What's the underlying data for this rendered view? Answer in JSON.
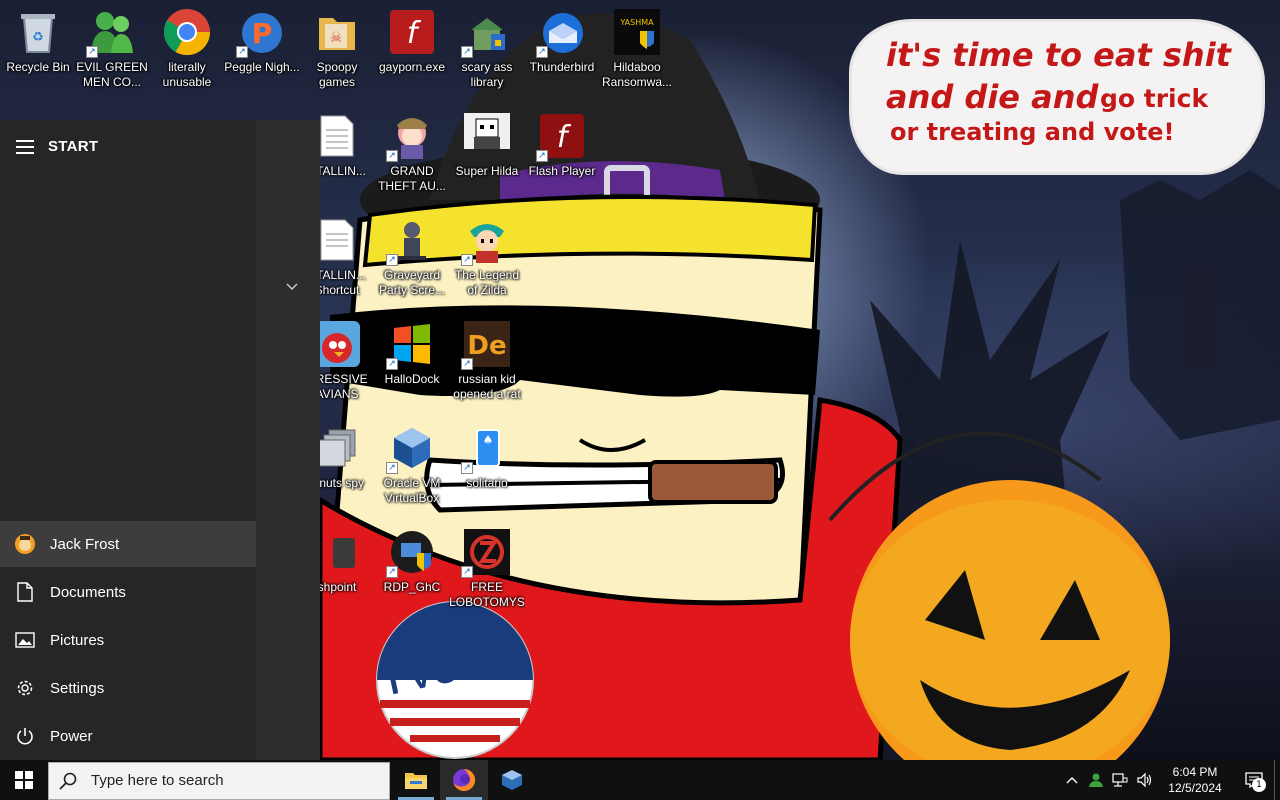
{
  "wallpaper": {
    "speech_bubble": {
      "line1": "it's time to eat shit",
      "line2a": "and die and",
      "line2b": "go trick",
      "line3": "or treating and vote!"
    },
    "sticker_text": "I VOTED"
  },
  "desktop_icons": [
    {
      "label": "Recycle Bin",
      "icon": "recycle-bin-icon"
    },
    {
      "label": "EVIL GREEN MEN CO...",
      "icon": "messenger-icon"
    },
    {
      "label": "literally unusable",
      "icon": "chrome-icon"
    },
    {
      "label": "Peggle Nigh...",
      "icon": "peggle-icon"
    },
    {
      "label": "Spoopy games",
      "icon": "folder-icon"
    },
    {
      "label": "gayporn.exe",
      "icon": "flash-icon"
    },
    {
      "label": "scary ass library",
      "icon": "library-icon"
    },
    {
      "label": "Thunderbird",
      "icon": "thunderbird-icon"
    },
    {
      "label": "Hildaboo Ransomwa...",
      "icon": "yashma-icon"
    },
    {
      "label": "STALLIN...",
      "icon": "text-file-icon"
    },
    {
      "label": "GRAND THEFT AU...",
      "icon": "anime-girl-icon"
    },
    {
      "label": "Super Hilda",
      "icon": "pixel-hilda-icon"
    },
    {
      "label": "Flash Player",
      "icon": "flash-player-icon"
    },
    {
      "label": "STALLIN... Shortcut",
      "icon": "text-file-icon"
    },
    {
      "label": "Graveyard Party Scre...",
      "icon": "graveyard-icon"
    },
    {
      "label": "The Legend of Zilda",
      "icon": "zilda-icon"
    },
    {
      "label": "GRESSIVE AVIANS",
      "icon": "angry-bird-icon"
    },
    {
      "label": "HalloDock",
      "icon": "windows-logo-icon"
    },
    {
      "label": "russian kid opened a rat",
      "icon": "de-icon"
    },
    {
      "label": "z nuts spy",
      "icon": "windows-stack-icon"
    },
    {
      "label": "Oracle VM VirtualBox",
      "icon": "virtualbox-icon"
    },
    {
      "label": "solitario",
      "icon": "solitaire-icon"
    },
    {
      "label": "shpoint",
      "icon": "app-icon"
    },
    {
      "label": "RDP_GhC",
      "icon": "rdp-icon"
    },
    {
      "label": "FREE LOBOTOMYS",
      "icon": "lobotomy-icon"
    }
  ],
  "start_menu": {
    "title": "START",
    "user": "Jack Frost",
    "items": [
      {
        "label": "Documents",
        "icon": "document-icon"
      },
      {
        "label": "Pictures",
        "icon": "pictures-icon"
      },
      {
        "label": "Settings",
        "icon": "gear-icon"
      },
      {
        "label": "Power",
        "icon": "power-icon"
      }
    ]
  },
  "taskbar": {
    "search_placeholder": "Type here to search",
    "apps": [
      {
        "name": "File Explorer",
        "icon": "file-explorer-icon"
      },
      {
        "name": "Firefox",
        "icon": "firefox-icon"
      },
      {
        "name": "VirtualBox",
        "icon": "virtualbox-icon"
      }
    ],
    "clock_time": "6:04 PM",
    "clock_date": "12/5/2024",
    "notification_count": "1"
  }
}
